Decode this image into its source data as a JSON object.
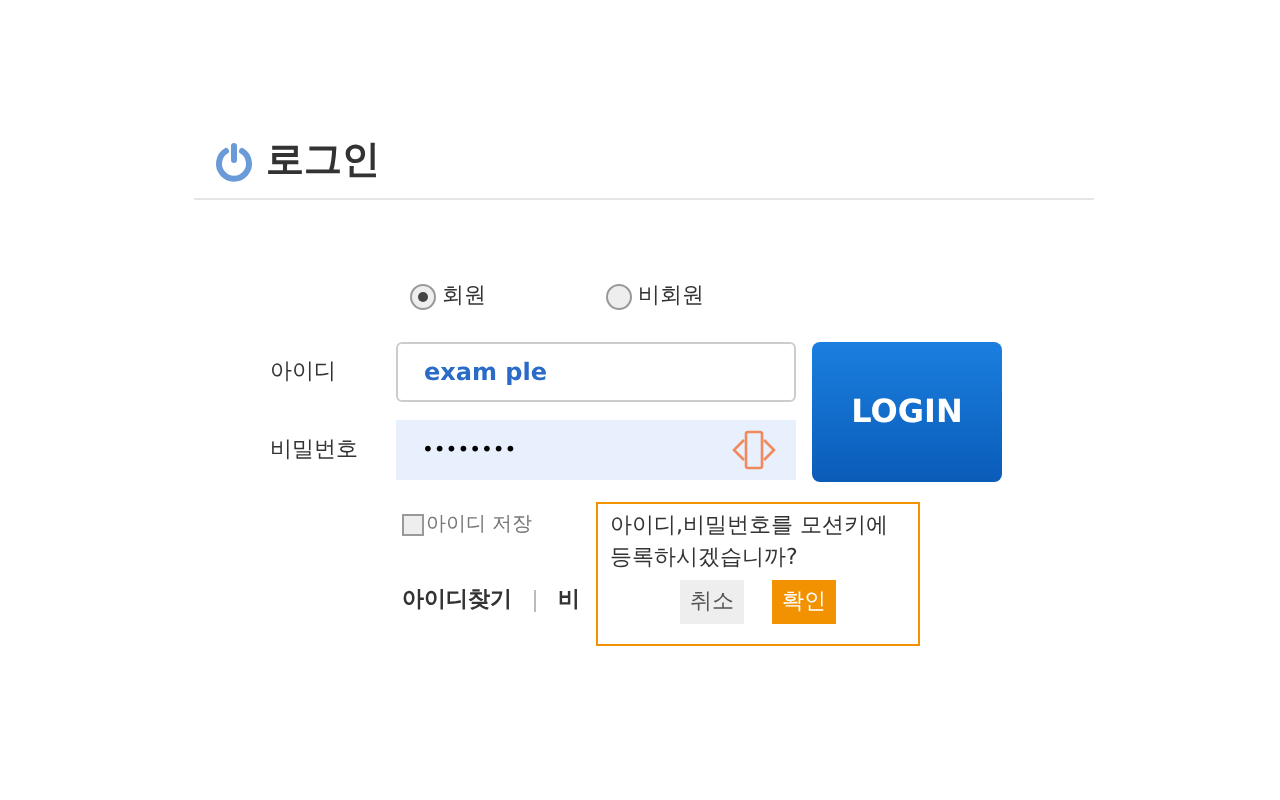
{
  "title": "로그인",
  "member_types": [
    {
      "label": "회원",
      "selected": true
    },
    {
      "label": "비회원",
      "selected": false
    }
  ],
  "id_field": {
    "label": "아이디",
    "value": "exam ple"
  },
  "password_field": {
    "label": "비밀번호",
    "value": "••••••••"
  },
  "login_button": "LOGIN",
  "save_id": {
    "label": "아이디 저장",
    "checked": false
  },
  "links": [
    "아이디찾기",
    "비"
  ],
  "popup": {
    "message": "아이디,비밀번호를 모션키에 등록하시겠습니까?",
    "buttons": [
      {
        "label": "취소",
        "kind": "cancel"
      },
      {
        "label": "확인",
        "kind": "confirm"
      }
    ]
  }
}
